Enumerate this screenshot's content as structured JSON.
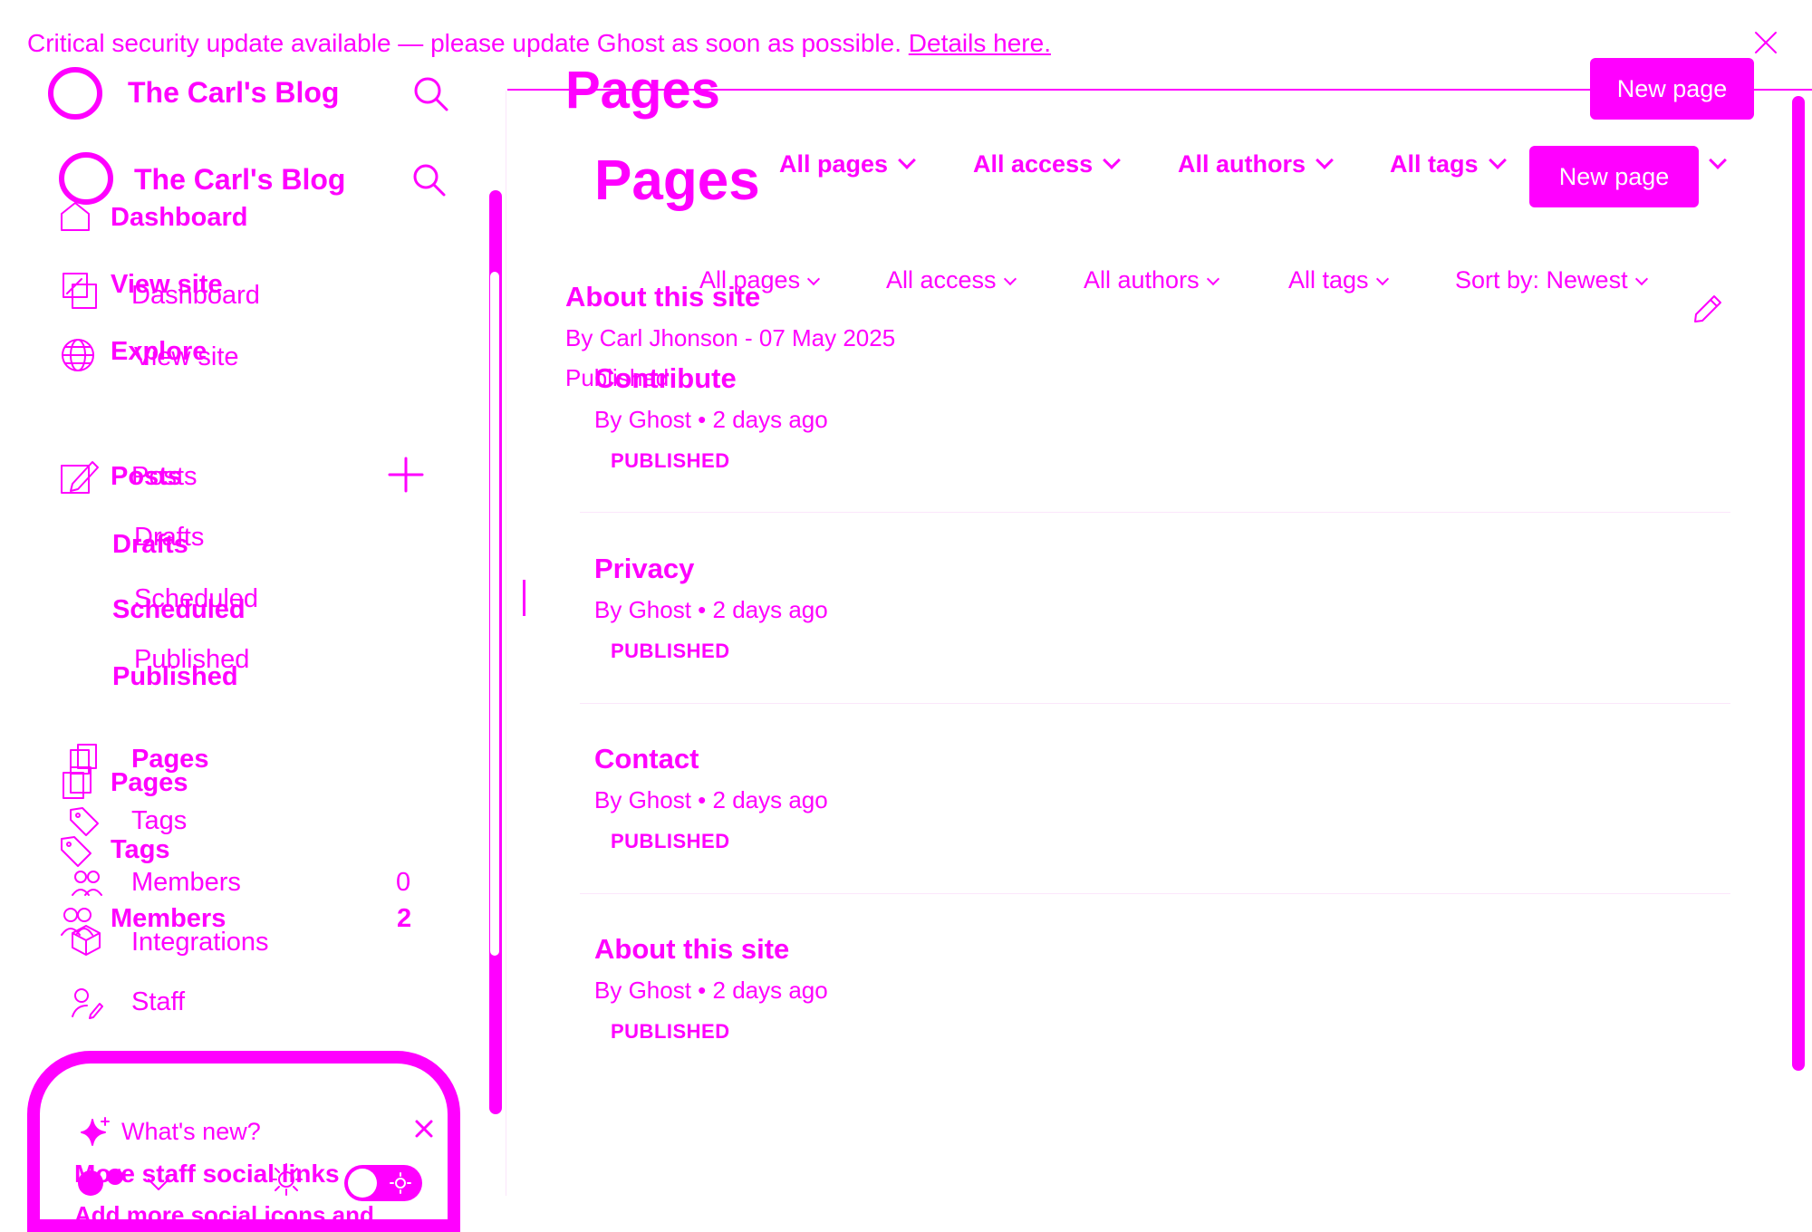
{
  "banner": {
    "message": "Critical security update available — please update Ghost as soon as possible.",
    "link": "Details here."
  },
  "site": {
    "name": "The Carl's Blog"
  },
  "sidebar_back": {
    "dashboard": "Dashboard",
    "view_site": "View site",
    "explore": "Explore",
    "posts": "Posts",
    "drafts": "Drafts",
    "scheduled": "Scheduled",
    "published": "Published",
    "pages": "Pages",
    "tags": "Tags",
    "members": "Members",
    "members_count": "2"
  },
  "sidebar_front": {
    "dashboard": "Dashboard",
    "view_site": "View site",
    "posts": "Posts",
    "drafts": "Drafts",
    "scheduled": "Scheduled",
    "published": "Published",
    "pages": "Pages",
    "tags": "Tags",
    "members": "Members",
    "members_count": "0",
    "integrations": "Integrations",
    "staff": "Staff"
  },
  "whats_new": {
    "label": "What's new?",
    "headline": "More staff social links",
    "body_partial": "Add more social icons and"
  },
  "header_back": {
    "title": "Pages",
    "new_page": "New page",
    "filters": [
      "All pages",
      "All access",
      "All authors",
      "All tags"
    ],
    "sort_partial": "t"
  },
  "header_front": {
    "title": "Pages",
    "new_page": "New page",
    "filters": [
      "All pages",
      "All access",
      "All authors",
      "All tags",
      "Sort by: Newest"
    ]
  },
  "back_page": {
    "title": "About this site",
    "meta": "By Carl Jhonson - 07 May 2025",
    "status": "Published"
  },
  "pages": [
    {
      "title": "Contribute",
      "author": "By Ghost",
      "sep": "•",
      "time": "2 days ago",
      "status": "PUBLISHED"
    },
    {
      "title": "Privacy",
      "author": "By Ghost",
      "sep": "•",
      "time": "2 days ago",
      "status": "PUBLISHED"
    },
    {
      "title": "Contact",
      "author": "By Ghost",
      "sep": "•",
      "time": "2 days ago",
      "status": "PUBLISHED"
    },
    {
      "title": "About this site",
      "author": "By Ghost",
      "sep": "•",
      "time": "2 days ago",
      "status": "PUBLISHED"
    }
  ],
  "colors": {
    "accent": "#ff00ff",
    "background": "#ffffff"
  }
}
